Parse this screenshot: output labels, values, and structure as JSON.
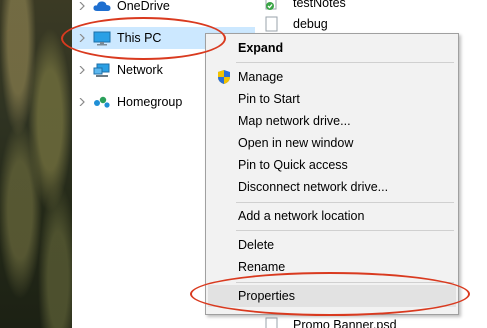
{
  "nav": {
    "items": [
      {
        "label": "OneDrive",
        "icon": "onedrive-cloud-icon"
      },
      {
        "label": "This PC",
        "icon": "this-pc-monitor-icon",
        "selected": true
      },
      {
        "label": "Network",
        "icon": "network-icon"
      },
      {
        "label": "Homegroup",
        "icon": "homegroup-icon"
      }
    ]
  },
  "files": {
    "items": [
      {
        "label": "testNotes"
      },
      {
        "label": "debug"
      },
      {
        "label": "Promo Banner.psd"
      }
    ]
  },
  "context_menu": {
    "items": [
      {
        "label": "Expand",
        "bold": true
      },
      {
        "label": "Manage",
        "icon": "shield-uac-icon"
      },
      {
        "label": "Pin to Start"
      },
      {
        "label": "Map network drive..."
      },
      {
        "label": "Open in new window"
      },
      {
        "label": "Pin to Quick access"
      },
      {
        "label": "Disconnect network drive..."
      },
      {
        "label": "Add a network location"
      },
      {
        "label": "Delete"
      },
      {
        "label": "Rename"
      },
      {
        "label": "Properties",
        "hovered": true
      }
    ]
  },
  "colors": {
    "selection": "#cce8ff",
    "annotation": "#d93a1f",
    "menu_bg": "#f2f2f2"
  }
}
